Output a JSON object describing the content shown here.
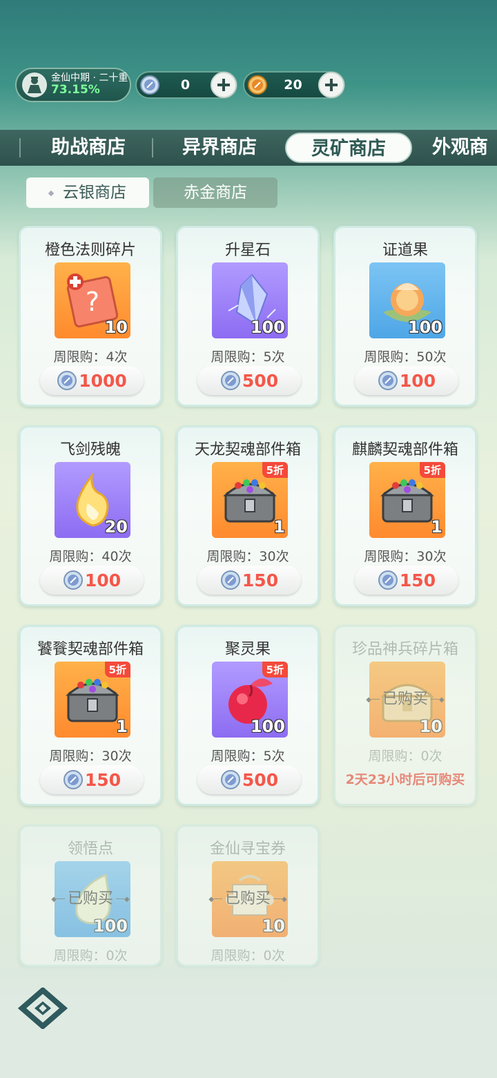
{
  "status": {
    "realm_level": "金仙中期 · 二十重",
    "realm_progress": "73.15%",
    "silver": "0",
    "gold": "20"
  },
  "tabs": [
    "助战商店",
    "异界商店",
    "灵矿商店",
    "外观商"
  ],
  "active_tab_index": 2,
  "subtabs": [
    "云银商店",
    "赤金商店"
  ],
  "active_subtab_index": 0,
  "items": [
    {
      "name": "橙色法则碎片",
      "qty": "10",
      "limit": "周限购：4次",
      "price": "1000",
      "art": "orange-rune-icon",
      "bg": "orange"
    },
    {
      "name": "升星石",
      "qty": "100",
      "limit": "周限购：5次",
      "price": "500",
      "art": "crystal-icon",
      "bg": "purple"
    },
    {
      "name": "证道果",
      "qty": "100",
      "limit": "周限购：50次",
      "price": "100",
      "art": "lotus-fruit-icon",
      "bg": "blue"
    },
    {
      "name": "飞剑残魄",
      "qty": "20",
      "limit": "周限购：40次",
      "price": "100",
      "art": "flame-spirit-icon",
      "bg": "purple"
    },
    {
      "name": "天龙契魂部件箱",
      "qty": "1",
      "limit": "周限购：30次",
      "price": "150",
      "discount": "5折",
      "art": "chest-icon",
      "bg": "orange"
    },
    {
      "name": "麒麟契魂部件箱",
      "qty": "1",
      "limit": "周限购：30次",
      "price": "150",
      "discount": "5折",
      "art": "chest-icon",
      "bg": "orange"
    },
    {
      "name": "饕餮契魂部件箱",
      "qty": "1",
      "limit": "周限购：30次",
      "price": "150",
      "discount": "5折",
      "art": "chest-icon",
      "bg": "orange"
    },
    {
      "name": "聚灵果",
      "qty": "100",
      "limit": "周限购：5次",
      "price": "500",
      "discount": "5折",
      "art": "red-fruit-icon",
      "bg": "purple"
    },
    {
      "name": "珍品神兵碎片箱",
      "qty": "10",
      "limit": "周限购：0次",
      "bought": "已购买",
      "timer": "2天23小时后可购买",
      "art": "gold-chest-icon",
      "bg": "orange"
    },
    {
      "name": "领悟点",
      "qty": "100",
      "limit": "周限购：0次",
      "bought": "已购买",
      "art": "drop-icon",
      "bg": "blue"
    },
    {
      "name": "金仙寻宝券",
      "qty": "10",
      "limit": "周限购：0次",
      "bought": "已购买",
      "art": "scroll-icon",
      "bg": "orange"
    }
  ]
}
